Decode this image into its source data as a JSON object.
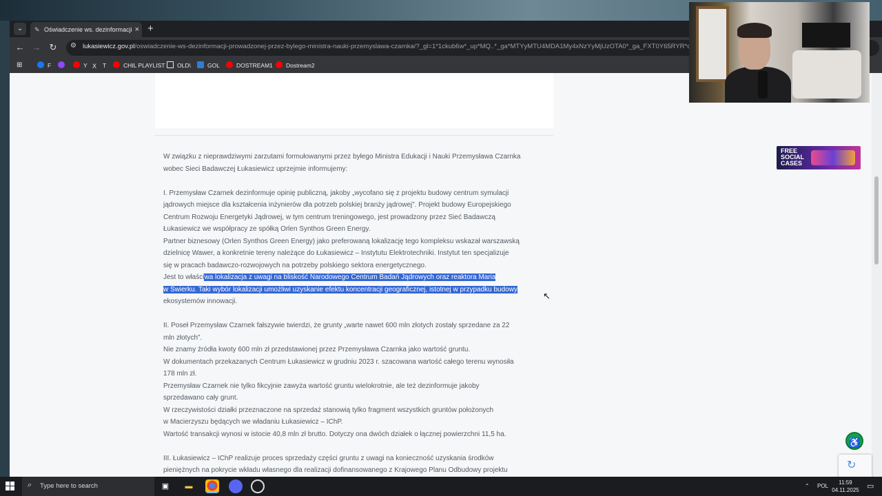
{
  "browser": {
    "tab_title": "Oświadczenie ws. dezinformacji",
    "tab_close": "×",
    "new_tab": "+",
    "url_domain": "lukasiewicz.gov.pl",
    "url_path": "/oswiadczenie-ws-dezinformacji-prowadzonej-przez-bylego-ministra-nauki-przemyslawa-czarnka/?_gl=1*1ckub6w*_up*MQ..*_ga*MTYyMTU4MDA1My4xNzYyMjUzOTA0*_ga_FXT0Y65RYR*czE3Nj",
    "bookmarks": [
      {
        "label": "F",
        "color": "#1877f2"
      },
      {
        "label": "",
        "color": "#9146ff"
      },
      {
        "label": "Y",
        "color": "#ff0000"
      },
      {
        "label": "T",
        "color": "#e8eaed"
      },
      {
        "label": "CHIL PLAYLIST",
        "color": "#ff0000"
      },
      {
        "label": "OLD\\",
        "color": "#e8eaed"
      },
      {
        "label": "GOL",
        "color": "#2d7fd3"
      },
      {
        "label": "DOSTREAM1",
        "color": "#ff0000"
      },
      {
        "label": "Dostream2",
        "color": "#ff0000"
      }
    ]
  },
  "article": {
    "intro": [
      "W związku z nieprawdziwymi zarzutami formułowanymi przez byłego Ministra Edukacji i Nauki Przemysława Czarnka",
      "wobec Sieci Badawczej Łukasiewicz uprzejmie informujemy:"
    ],
    "section1": {
      "lines": [
        "I.    Przemysław Czarnek dezinformuje opinię publiczną, jakoby „wycofano się z projektu budowy centrum symulacji",
        "jądrowych miejsce dla kształcenia inżynierów dla potrzeb polskiej branży jądrowej”. Projekt budowy Europejskiego",
        "Centrum Rozwoju Energetyki Jądrowej, w tym centrum treningowego, jest prowadzony przez Sieć Badawczą",
        "Łukasiewicz we współpracy ze spółką Orlen Synthos Green Energy.",
        "Partner biznesowy (Orlen Synthos Green Energy) jako preferowaną lokalizację tego kompleksu wskazał warszawską",
        "dzielnicę Wawer, a konkretnie tereny należące do Łukasiewicz – Instytutu Elektrotechniki. Instytut ten specjalizuje",
        "się w pracach badawczo-rozwojowych na potrzeby polskiego sektora energetycznego."
      ],
      "sel_prefix": "Jest to właści",
      "sel_line1": "wa lokalizacja z uwagi na bliskość Narodowego Centrum Badań Jądrowych oraz reaktora Maria",
      "sel_line2": "w Świerku. Taki wybór lokalizacji umożliwi uzyskanie efektu koncentracji geograficznej, istotnej w przypadku budowy",
      "last_line": "ekosystemów innowacji."
    },
    "section2": [
      "II.    Poseł Przemysław Czarnek fałszywie twierdzi, że grunty „warte nawet 600 mln złotych zostały sprzedane za 22",
      "mln złotych”.",
      "Nie znamy źródła kwoty 600 mln zł przedstawionej przez Przemysława Czarnka jako wartość gruntu.",
      "W dokumentach przekazanych Centrum Łukasiewicz w grudniu 2023 r. szacowana wartość całego terenu wynosiła",
      "178 mln zł.",
      "Przemysław Czarnek nie tylko fikcyjnie zawyża wartość gruntu wielokrotnie, ale też dezinformuje jakoby",
      "sprzedawano cały grunt.",
      "W rzeczywistości działki przeznaczone na sprzedaż stanowią tylko fragment wszystkich gruntów położonych",
      "w Macierzyszu będących we władaniu Łukasiewicz – IChP.",
      "Wartość transakcji wynosi w istocie 40,8 mln zł brutto. Dotyczy ona dwóch działek o łącznej powierzchni 11,5 ha."
    ],
    "section3": [
      "III.    Łukasiewicz – IChP realizuje proces sprzedaży części gruntu z uwagi na konieczność uzyskania środków",
      "pieniężnych na pokrycie wkładu własnego dla realizacji dofinansowanego z Krajowego Planu Odbudowy projektu"
    ]
  },
  "ad": {
    "text": "FREE SOCIAL CASES"
  },
  "taskbar": {
    "search_placeholder": "Type here to search",
    "language": "POL",
    "time": "11:59",
    "date": "04.11.2025"
  },
  "colors": {
    "selection": "#3367d6",
    "accessibility": "#12a14a",
    "text": "#545b63"
  }
}
